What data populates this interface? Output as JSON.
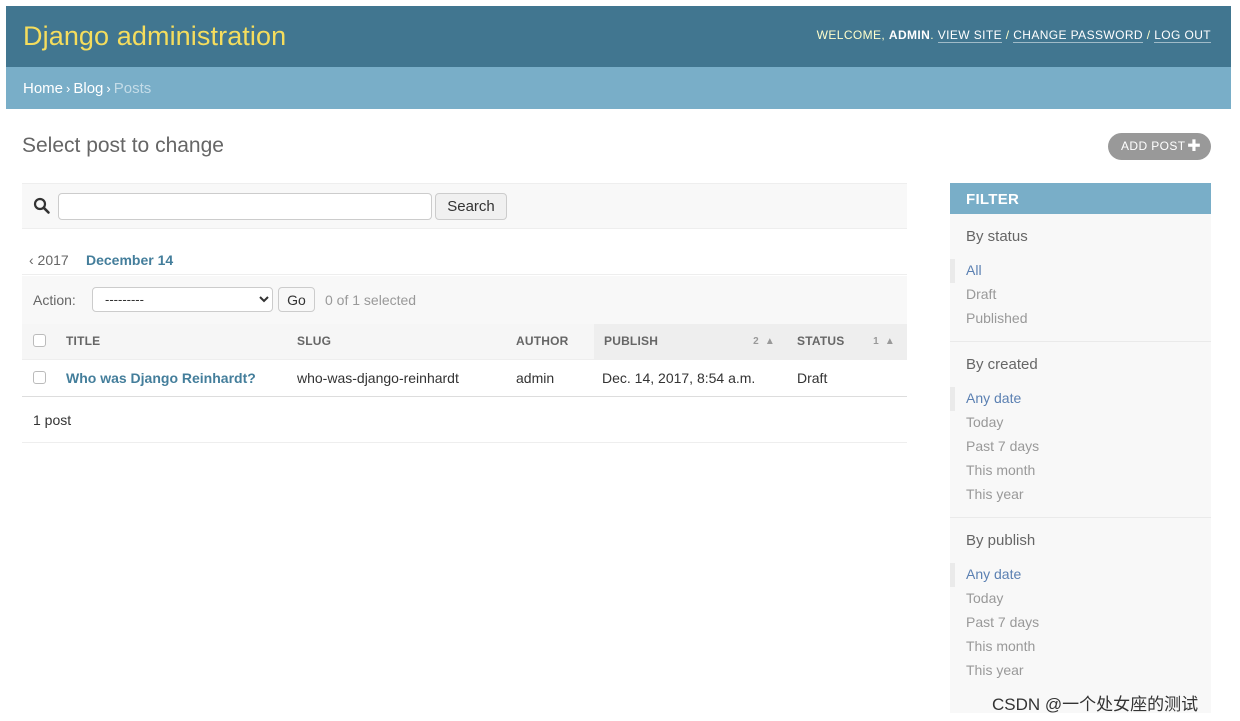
{
  "header": {
    "brand": "Django administration",
    "welcome": "WELCOME,",
    "username": "ADMIN",
    "view_site": "VIEW SITE",
    "change_password": "CHANGE PASSWORD",
    "log_out": "LOG OUT"
  },
  "breadcrumbs": {
    "home": "Home",
    "app": "Blog",
    "current": "Posts"
  },
  "page": {
    "title": "Select post to change",
    "add_button": "ADD POST",
    "add_icon": "plus-icon"
  },
  "search": {
    "value": "",
    "button": "Search",
    "icon": "search-icon"
  },
  "date_hierarchy": {
    "back": "‹ 2017",
    "current": "December 14"
  },
  "actions": {
    "label": "Action:",
    "selected": "---------",
    "go": "Go",
    "counter": "0 of 1 selected"
  },
  "table": {
    "headers": {
      "title": "TITLE",
      "slug": "SLUG",
      "author": "AUTHOR",
      "publish": "PUBLISH",
      "status": "STATUS"
    },
    "sort_priority": {
      "publish": "2",
      "status": "1"
    },
    "rows": [
      {
        "title": "Who was Django Reinhardt?",
        "slug": "who-was-django-reinhardt",
        "author": "admin",
        "publish": "Dec. 14, 2017, 8:54 a.m.",
        "status": "Draft"
      }
    ]
  },
  "paginator": {
    "text": "1 post"
  },
  "filter": {
    "title": "FILTER",
    "by_status": {
      "title": "By status",
      "items": [
        "All",
        "Draft",
        "Published"
      ]
    },
    "by_created": {
      "title": "By created",
      "items": [
        "Any date",
        "Today",
        "Past 7 days",
        "This month",
        "This year"
      ]
    },
    "by_publish": {
      "title": "By publish",
      "items": [
        "Any date",
        "Today",
        "Past 7 days",
        "This month",
        "This year"
      ]
    }
  },
  "watermark": "CSDN @一个处女座的测试",
  "colors": {
    "header": "#417690",
    "breadcrumbs": "#79aec8",
    "brand": "#f5dd5d",
    "link": "#447e9b"
  }
}
